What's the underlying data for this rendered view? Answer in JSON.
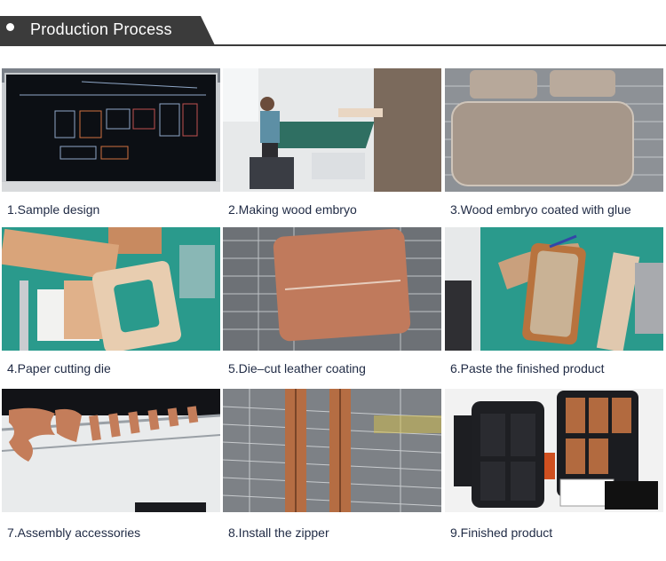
{
  "header": {
    "title": "Production Process"
  },
  "steps": [
    {
      "caption": "1.Sample design",
      "image": "cad-design-monitor"
    },
    {
      "caption": "2.Making wood embryo",
      "image": "worker-at-cutting-table"
    },
    {
      "caption": "3.Wood embryo coated with glue",
      "image": "glued-wood-blocks-on-rack"
    },
    {
      "caption": "4.Paper cutting die",
      "image": "leather-and-cutting-die"
    },
    {
      "caption": "5.Die–cut leather coating",
      "image": "leather-covered-block-on-wire-rack"
    },
    {
      "caption": "6.Paste the finished product",
      "image": "hands-pasting-leather"
    },
    {
      "caption": "7.Assembly accessories",
      "image": "leather-tabs-on-rods"
    },
    {
      "caption": "8.Install the zipper",
      "image": "zipper-strips-on-rack"
    },
    {
      "caption": "9.Finished product",
      "image": "open-black-case"
    }
  ],
  "colors": {
    "header_bg": "#3b3b3b",
    "caption_text": "#1f2a44"
  }
}
